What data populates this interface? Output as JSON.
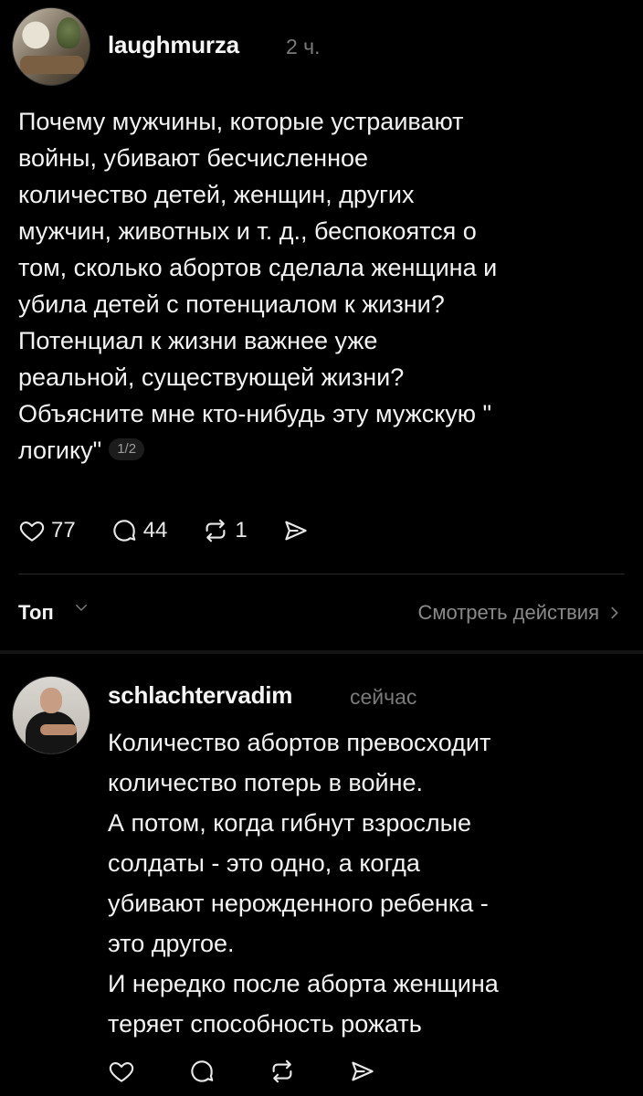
{
  "post": {
    "username": "laughmurza",
    "time": "2 ч.",
    "lines": [
      "Почему мужчины, которые устраивают",
      "войны, убивают бесчисленное",
      "количество детей, женщин, других",
      "мужчин, животных и т. д., беспокоятся о",
      "том, сколько абортов сделала женщина и",
      "убила детей с потенциалом к жизни?",
      "Потенциал к жизни важнее уже",
      "реальной, существующей жизни?",
      "Объясните мне кто-нибудь эту мужскую \"",
      "логику\""
    ],
    "page_indicator": "1/2",
    "likes": "77",
    "comments": "44",
    "reposts": "1",
    "icons": [
      "heart-icon",
      "comment-icon",
      "repost-icon",
      "share-icon"
    ]
  },
  "sort_bar": {
    "label": "Топ",
    "view_activity": "Смотреть действия"
  },
  "reply": {
    "username": "schlachtervadim",
    "time": "сейчас",
    "lines": [
      "Количество абортов превосходит",
      "количество потерь в войне.",
      "А потом, когда гибнут взрослые",
      "солдаты - это одно, а когда",
      "убивают нерожденного ребенка -",
      "это другое.",
      "И нередко после аборта женщина",
      "теряет способность рожать"
    ]
  },
  "colors": {
    "background": "#000000",
    "text": "#f3f3f3",
    "muted": "#7a7a7a"
  }
}
